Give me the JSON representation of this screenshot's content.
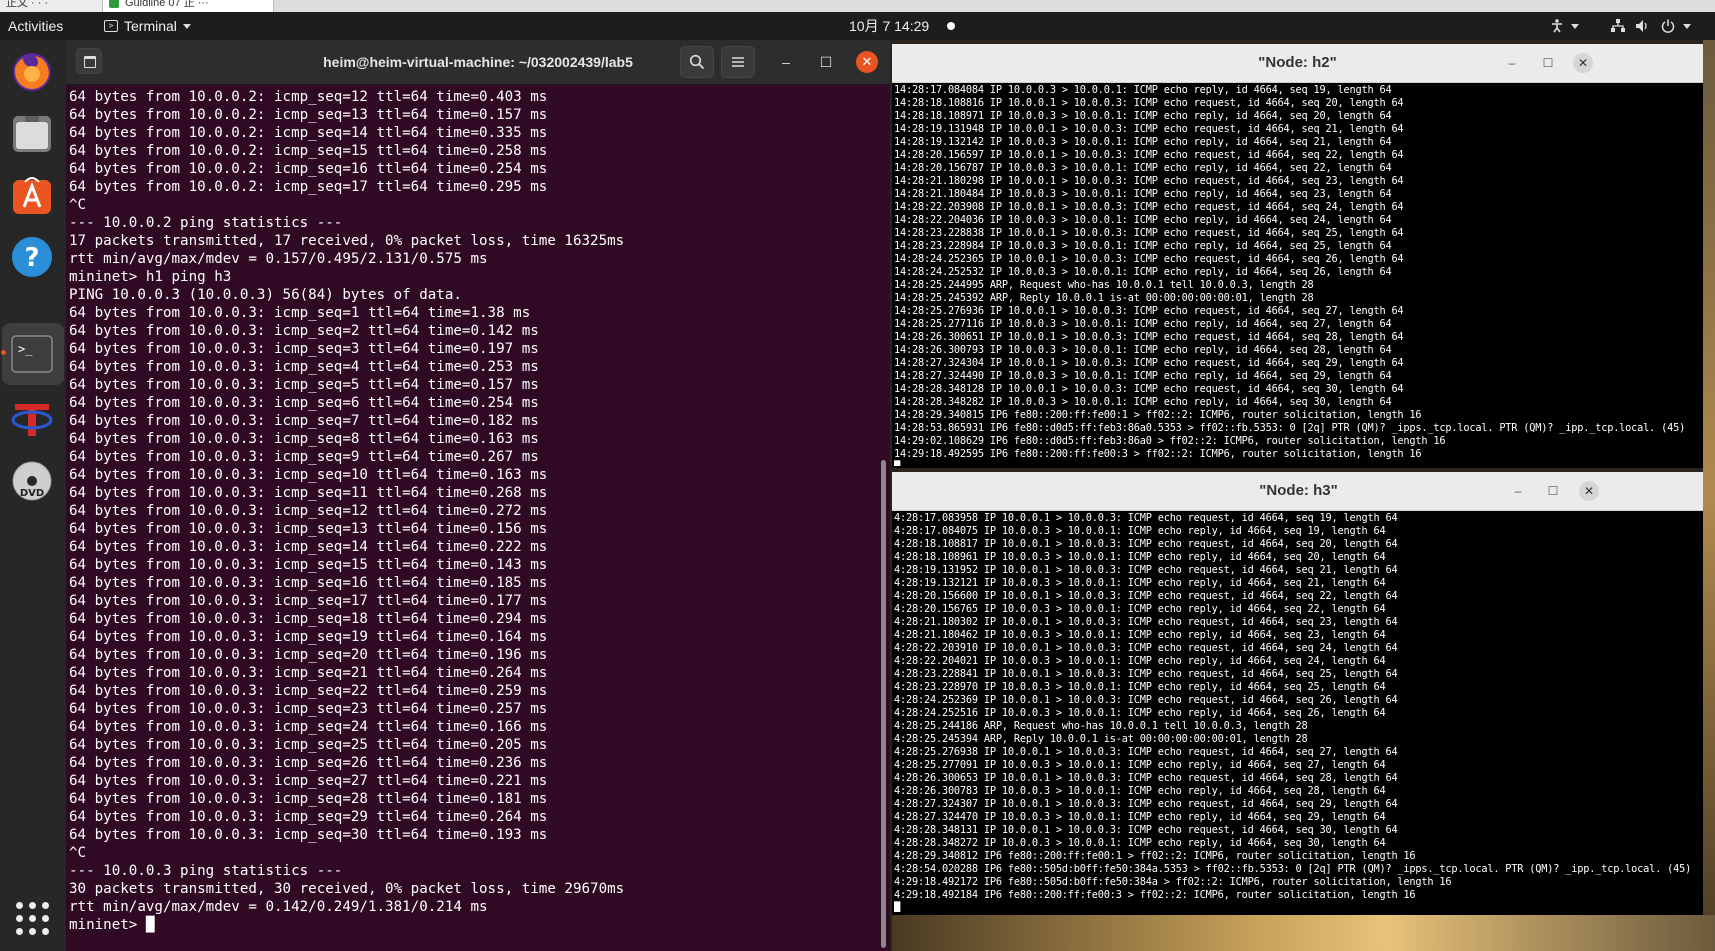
{
  "host": {
    "tab1": "正文 · · ·",
    "tab2": "Guidline 07 正 ···"
  },
  "topbar": {
    "activities": "Activities",
    "app_name": "Terminal",
    "clock": "10月 7  14:29"
  },
  "dock": {
    "items": [
      "firefox-icon",
      "files-icon",
      "software-icon",
      "help-icon",
      "terminal-icon",
      "texstudio-icon",
      "dvd-icon"
    ]
  },
  "main_terminal": {
    "title": "heim@heim-virtual-machine: ~/032002439/lab5",
    "lines": [
      "64 bytes from 10.0.0.2: icmp_seq=12 ttl=64 time=0.403 ms",
      "64 bytes from 10.0.0.2: icmp_seq=13 ttl=64 time=0.157 ms",
      "64 bytes from 10.0.0.2: icmp_seq=14 ttl=64 time=0.335 ms",
      "64 bytes from 10.0.0.2: icmp_seq=15 ttl=64 time=0.258 ms",
      "64 bytes from 10.0.0.2: icmp_seq=16 ttl=64 time=0.254 ms",
      "64 bytes from 10.0.0.2: icmp_seq=17 ttl=64 time=0.295 ms",
      "^C",
      "--- 10.0.0.2 ping statistics ---",
      "17 packets transmitted, 17 received, 0% packet loss, time 16325ms",
      "rtt min/avg/max/mdev = 0.157/0.495/2.131/0.575 ms",
      "mininet> h1 ping h3",
      "PING 10.0.0.3 (10.0.0.3) 56(84) bytes of data.",
      "64 bytes from 10.0.0.3: icmp_seq=1 ttl=64 time=1.38 ms",
      "64 bytes from 10.0.0.3: icmp_seq=2 ttl=64 time=0.142 ms",
      "64 bytes from 10.0.0.3: icmp_seq=3 ttl=64 time=0.197 ms",
      "64 bytes from 10.0.0.3: icmp_seq=4 ttl=64 time=0.253 ms",
      "64 bytes from 10.0.0.3: icmp_seq=5 ttl=64 time=0.157 ms",
      "64 bytes from 10.0.0.3: icmp_seq=6 ttl=64 time=0.254 ms",
      "64 bytes from 10.0.0.3: icmp_seq=7 ttl=64 time=0.182 ms",
      "64 bytes from 10.0.0.3: icmp_seq=8 ttl=64 time=0.163 ms",
      "64 bytes from 10.0.0.3: icmp_seq=9 ttl=64 time=0.267 ms",
      "64 bytes from 10.0.0.3: icmp_seq=10 ttl=64 time=0.163 ms",
      "64 bytes from 10.0.0.3: icmp_seq=11 ttl=64 time=0.268 ms",
      "64 bytes from 10.0.0.3: icmp_seq=12 ttl=64 time=0.272 ms",
      "64 bytes from 10.0.0.3: icmp_seq=13 ttl=64 time=0.156 ms",
      "64 bytes from 10.0.0.3: icmp_seq=14 ttl=64 time=0.222 ms",
      "64 bytes from 10.0.0.3: icmp_seq=15 ttl=64 time=0.143 ms",
      "64 bytes from 10.0.0.3: icmp_seq=16 ttl=64 time=0.185 ms",
      "64 bytes from 10.0.0.3: icmp_seq=17 ttl=64 time=0.177 ms",
      "64 bytes from 10.0.0.3: icmp_seq=18 ttl=64 time=0.294 ms",
      "64 bytes from 10.0.0.3: icmp_seq=19 ttl=64 time=0.164 ms",
      "64 bytes from 10.0.0.3: icmp_seq=20 ttl=64 time=0.196 ms",
      "64 bytes from 10.0.0.3: icmp_seq=21 ttl=64 time=0.264 ms",
      "64 bytes from 10.0.0.3: icmp_seq=22 ttl=64 time=0.259 ms",
      "64 bytes from 10.0.0.3: icmp_seq=23 ttl=64 time=0.257 ms",
      "64 bytes from 10.0.0.3: icmp_seq=24 ttl=64 time=0.166 ms",
      "64 bytes from 10.0.0.3: icmp_seq=25 ttl=64 time=0.205 ms",
      "64 bytes from 10.0.0.3: icmp_seq=26 ttl=64 time=0.236 ms",
      "64 bytes from 10.0.0.3: icmp_seq=27 ttl=64 time=0.221 ms",
      "64 bytes from 10.0.0.3: icmp_seq=28 ttl=64 time=0.181 ms",
      "64 bytes from 10.0.0.3: icmp_seq=29 ttl=64 time=0.264 ms",
      "64 bytes from 10.0.0.3: icmp_seq=30 ttl=64 time=0.193 ms",
      "^C",
      "--- 10.0.0.3 ping statistics ---",
      "30 packets transmitted, 30 received, 0% packet loss, time 29670ms",
      "rtt min/avg/max/mdev = 0.142/0.249/1.381/0.214 ms",
      "mininet> █"
    ]
  },
  "node_h2": {
    "title": "\"Node: h2\"",
    "lines": [
      "14:28:17.084084 IP 10.0.0.3 > 10.0.0.1: ICMP echo reply, id 4664, seq 19, length 64",
      "14:28:18.108816 IP 10.0.0.1 > 10.0.0.3: ICMP echo request, id 4664, seq 20, length 64",
      "14:28:18.108971 IP 10.0.0.3 > 10.0.0.1: ICMP echo reply, id 4664, seq 20, length 64",
      "14:28:19.131948 IP 10.0.0.1 > 10.0.0.3: ICMP echo request, id 4664, seq 21, length 64",
      "14:28:19.132142 IP 10.0.0.3 > 10.0.0.1: ICMP echo reply, id 4664, seq 21, length 64",
      "14:28:20.156597 IP 10.0.0.1 > 10.0.0.3: ICMP echo request, id 4664, seq 22, length 64",
      "14:28:20.156787 IP 10.0.0.3 > 10.0.0.1: ICMP echo reply, id 4664, seq 22, length 64",
      "14:28:21.180298 IP 10.0.0.1 > 10.0.0.3: ICMP echo request, id 4664, seq 23, length 64",
      "14:28:21.180484 IP 10.0.0.3 > 10.0.0.1: ICMP echo reply, id 4664, seq 23, length 64",
      "14:28:22.203908 IP 10.0.0.1 > 10.0.0.3: ICMP echo request, id 4664, seq 24, length 64",
      "14:28:22.204036 IP 10.0.0.3 > 10.0.0.1: ICMP echo reply, id 4664, seq 24, length 64",
      "14:28:23.228838 IP 10.0.0.1 > 10.0.0.3: ICMP echo request, id 4664, seq 25, length 64",
      "14:28:23.228984 IP 10.0.0.3 > 10.0.0.1: ICMP echo reply, id 4664, seq 25, length 64",
      "14:28:24.252365 IP 10.0.0.1 > 10.0.0.3: ICMP echo request, id 4664, seq 26, length 64",
      "14:28:24.252532 IP 10.0.0.3 > 10.0.0.1: ICMP echo reply, id 4664, seq 26, length 64",
      "14:28:25.244995 ARP, Request who-has 10.0.0.1 tell 10.0.0.3, length 28",
      "14:28:25.245392 ARP, Reply 10.0.0.1 is-at 00:00:00:00:00:01, length 28",
      "14:28:25.276936 IP 10.0.0.1 > 10.0.0.3: ICMP echo request, id 4664, seq 27, length 64",
      "14:28:25.277116 IP 10.0.0.3 > 10.0.0.1: ICMP echo reply, id 4664, seq 27, length 64",
      "14:28:26.300651 IP 10.0.0.1 > 10.0.0.3: ICMP echo request, id 4664, seq 28, length 64",
      "14:28:26.300793 IP 10.0.0.3 > 10.0.0.1: ICMP echo reply, id 4664, seq 28, length 64",
      "14:28:27.324304 IP 10.0.0.1 > 10.0.0.3: ICMP echo request, id 4664, seq 29, length 64",
      "14:28:27.324490 IP 10.0.0.3 > 10.0.0.1: ICMP echo reply, id 4664, seq 29, length 64",
      "14:28:28.348128 IP 10.0.0.1 > 10.0.0.3: ICMP echo request, id 4664, seq 30, length 64",
      "14:28:28.348282 IP 10.0.0.3 > 10.0.0.1: ICMP echo reply, id 4664, seq 30, length 64",
      "14:28:29.340815 IP6 fe80::200:ff:fe00:1 > ff02::2: ICMP6, router solicitation, length 16",
      "14:28:53.865931 IP6 fe80::d0d5:ff:feb3:86a0.5353 > ff02::fb.5353: 0 [2q] PTR (QM)? _ipps._tcp.local. PTR (QM)? _ipp._tcp.local. (45)",
      "14:29:02.108629 IP6 fe80::d0d5:ff:feb3:86a0 > ff02::2: ICMP6, router solicitation, length 16",
      "14:29:18.492595 IP6 fe80::200:ff:fe00:3 > ff02::2: ICMP6, router solicitation, length 16",
      "█"
    ]
  },
  "node_h3": {
    "title": "\"Node: h3\"",
    "lines": [
      "4:28:17.083958 IP 10.0.0.1 > 10.0.0.3: ICMP echo request, id 4664, seq 19, length 64",
      "4:28:17.084075 IP 10.0.0.3 > 10.0.0.1: ICMP echo reply, id 4664, seq 19, length 64",
      "4:28:18.108817 IP 10.0.0.1 > 10.0.0.3: ICMP echo request, id 4664, seq 20, length 64",
      "4:28:18.108961 IP 10.0.0.3 > 10.0.0.1: ICMP echo reply, id 4664, seq 20, length 64",
      "4:28:19.131952 IP 10.0.0.1 > 10.0.0.3: ICMP echo request, id 4664, seq 21, length 64",
      "4:28:19.132121 IP 10.0.0.3 > 10.0.0.1: ICMP echo reply, id 4664, seq 21, length 64",
      "4:28:20.156600 IP 10.0.0.1 > 10.0.0.3: ICMP echo request, id 4664, seq 22, length 64",
      "4:28:20.156765 IP 10.0.0.3 > 10.0.0.1: ICMP echo reply, id 4664, seq 22, length 64",
      "4:28:21.180302 IP 10.0.0.1 > 10.0.0.3: ICMP echo request, id 4664, seq 23, length 64",
      "4:28:21.180462 IP 10.0.0.3 > 10.0.0.1: ICMP echo reply, id 4664, seq 23, length 64",
      "4:28:22.203910 IP 10.0.0.1 > 10.0.0.3: ICMP echo request, id 4664, seq 24, length 64",
      "4:28:22.204021 IP 10.0.0.3 > 10.0.0.1: ICMP echo reply, id 4664, seq 24, length 64",
      "4:28:23.228841 IP 10.0.0.1 > 10.0.0.3: ICMP echo request, id 4664, seq 25, length 64",
      "4:28:23.228970 IP 10.0.0.3 > 10.0.0.1: ICMP echo reply, id 4664, seq 25, length 64",
      "4:28:24.252369 IP 10.0.0.1 > 10.0.0.3: ICMP echo request, id 4664, seq 26, length 64",
      "4:28:24.252516 IP 10.0.0.3 > 10.0.0.1: ICMP echo reply, id 4664, seq 26, length 64",
      "4:28:25.244186 ARP, Request who-has 10.0.0.1 tell 10.0.0.3, length 28",
      "4:28:25.245394 ARP, Reply 10.0.0.1 is-at 00:00:00:00:00:01, length 28",
      "4:28:25.276938 IP 10.0.0.1 > 10.0.0.3: ICMP echo request, id 4664, seq 27, length 64",
      "4:28:25.277091 IP 10.0.0.3 > 10.0.0.1: ICMP echo reply, id 4664, seq 27, length 64",
      "4:28:26.300653 IP 10.0.0.1 > 10.0.0.3: ICMP echo request, id 4664, seq 28, length 64",
      "4:28:26.300783 IP 10.0.0.3 > 10.0.0.1: ICMP echo reply, id 4664, seq 28, length 64",
      "4:28:27.324307 IP 10.0.0.1 > 10.0.0.3: ICMP echo request, id 4664, seq 29, length 64",
      "4:28:27.324470 IP 10.0.0.3 > 10.0.0.1: ICMP echo reply, id 4664, seq 29, length 64",
      "4:28:28.348131 IP 10.0.0.1 > 10.0.0.3: ICMP echo request, id 4664, seq 30, length 64",
      "4:28:28.348272 IP 10.0.0.3 > 10.0.0.1: ICMP echo reply, id 4664, seq 30, length 64",
      "4:28:29.340812 IP6 fe80::200:ff:fe00:1 > ff02::2: ICMP6, router solicitation, length 16",
      "4:28:54.020288 IP6 fe80::505d:b0ff:fe50:384a.5353 > ff02::fb.5353: 0 [2q] PTR (QM)? _ipps._tcp.local. PTR (QM)? _ipp._tcp.local. (45)",
      "4:29:18.492172 IP6 fe80::505d:b0ff:fe50:384a > ff02::2: ICMP6, router solicitation, length 16",
      "4:29:18.492184 IP6 fe80::200:ff:fe00:3 > ff02::2: ICMP6, router solicitation, length 16",
      "█"
    ]
  },
  "colors": {
    "terminal_bg": "#300a24",
    "accent": "#e95420",
    "xterm_bg": "#000000"
  }
}
